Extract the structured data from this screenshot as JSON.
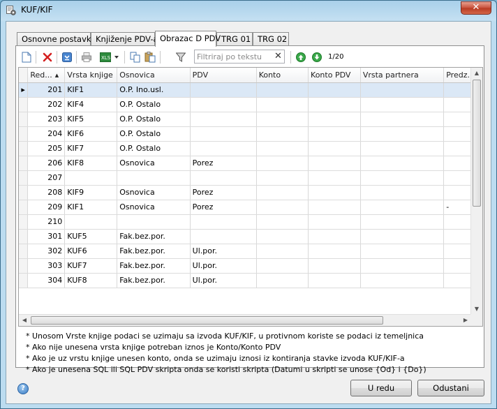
{
  "window": {
    "title": "KUF/KIF",
    "close_label": "✕"
  },
  "tabs": [
    {
      "label": "Osnovne postavke",
      "active": false
    },
    {
      "label": "Knjiženje PDV-a",
      "active": false
    },
    {
      "label": "Obrazac D PDV",
      "active": true
    },
    {
      "label": "TRG 01",
      "active": false
    },
    {
      "label": "TRG 02",
      "active": false
    }
  ],
  "toolbar": {
    "filter_placeholder": "Filtriraj po tekstu",
    "filter_value": "",
    "filter_clear": "✕",
    "page_counter": "1/20"
  },
  "grid": {
    "columns": [
      "Red...",
      "Vrsta knjige",
      "Osnovica",
      "PDV",
      "Konto",
      "Konto PDV",
      "Vrsta partnera",
      "Predz..."
    ],
    "rows": [
      {
        "red": "201",
        "vrsta": "KIF1",
        "osnovica": "O.P. Ino.usl.",
        "pdv": "",
        "predz": "",
        "selected": true
      },
      {
        "red": "202",
        "vrsta": "KIF4",
        "osnovica": "O.P. Ostalo",
        "pdv": "",
        "predz": ""
      },
      {
        "red": "203",
        "vrsta": "KIF5",
        "osnovica": "O.P. Ostalo",
        "pdv": "",
        "predz": ""
      },
      {
        "red": "204",
        "vrsta": "KIF6",
        "osnovica": "O.P. Ostalo",
        "pdv": "",
        "predz": ""
      },
      {
        "red": "205",
        "vrsta": "KIF7",
        "osnovica": "O.P. Ostalo",
        "pdv": "",
        "predz": ""
      },
      {
        "red": "206",
        "vrsta": "KIF8",
        "osnovica": "Osnovica",
        "pdv": "Porez",
        "predz": ""
      },
      {
        "red": "207",
        "vrsta": "",
        "osnovica": "",
        "pdv": "",
        "predz": ""
      },
      {
        "red": "208",
        "vrsta": "KIF9",
        "osnovica": "Osnovica",
        "pdv": "Porez",
        "predz": ""
      },
      {
        "red": "209",
        "vrsta": "KIF1",
        "osnovica": "Osnovica",
        "pdv": "Porez",
        "predz": "-"
      },
      {
        "red": "210",
        "vrsta": "",
        "osnovica": "",
        "pdv": "",
        "predz": ""
      },
      {
        "red": "301",
        "vrsta": "KUF5",
        "osnovica": "Fak.bez.por.",
        "pdv": "",
        "predz": ""
      },
      {
        "red": "302",
        "vrsta": "KUF6",
        "osnovica": "Fak.bez.por.",
        "pdv": "Ul.por.",
        "predz": ""
      },
      {
        "red": "303",
        "vrsta": "KUF7",
        "osnovica": "Fak.bez.por.",
        "pdv": "Ul.por.",
        "predz": ""
      },
      {
        "red": "304",
        "vrsta": "KUF8",
        "osnovica": "Fak.bez.por.",
        "pdv": "Ul.por.",
        "predz": ""
      }
    ]
  },
  "notes": [
    "* Unosom Vrste knjige podaci se uzimaju sa izvoda KUF/KIF, u protivnom koriste se podaci iz temeljnica",
    "* Ako nije unesena vrsta knjige potreban iznos je Konto/Konto PDV",
    "* Ako je uz vrstu knjige unesen konto, onda se uzimaju iznosi iz kontiranja stavke izvoda KUF/KIF-a",
    "* Ako je unesena SQL ili SQL PDV skripta onda se koristi skripta (Datumi u skripti se unose {Od} i {Do})"
  ],
  "buttons": {
    "ok": "U redu",
    "cancel": "Odustani",
    "help": "?"
  }
}
